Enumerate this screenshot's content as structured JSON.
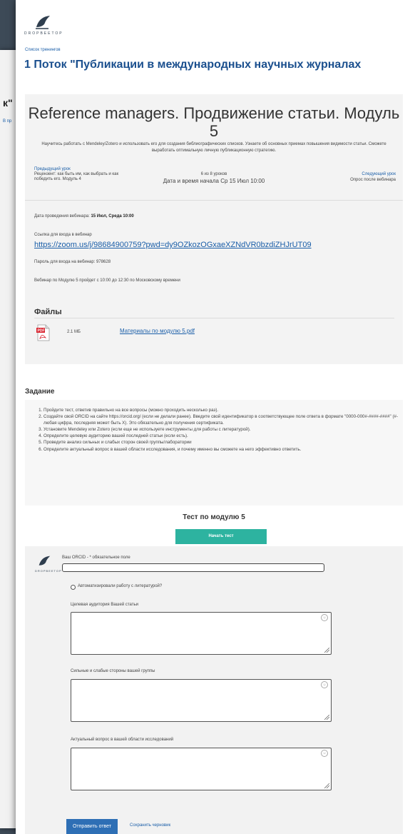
{
  "background_window": {
    "title_fragment": "к\"",
    "link_fragment": "В пр"
  },
  "logo": {
    "brand": "DROPBEETOP"
  },
  "breadcrumb": "Список тренингов",
  "course_title": "1 Поток \"Публикации в международных научных журналах",
  "module": {
    "title": "Reference managers. Продвижение статьи. Модуль 5",
    "description": "Научитесь работать с Mendeley/Zotero и использовать его для создания библиографических списков. Узнаете об основных приемах повышения видимости статьи. Сможете выработать оптимальную личную публикационную стратегию.",
    "prev_label": "Предыдущий урок",
    "prev_title": "Рецензент: как быть им, как выбрать и как победить его. Модуль 4",
    "lesson_count": "6 из 8 уроков",
    "start_date": "Дата и время начала Ср 15 Июл 10:00",
    "next_label": "Следующий урок",
    "next_title": "Опрос после вебинара",
    "webinar_date_label": "Дата проведения вебинара:",
    "webinar_date_value": "15 Июл, Среда 10:00",
    "zoom_label": "Ссылка для входа в вебинар",
    "zoom_link": "https://zoom.us/j/98684900759?pwd=dy9OZkozOGxaeXZNdVR0bzdiZHJrUT09",
    "password": "Пароль для входа на вебинар: 978628",
    "schedule": "Вебинар по Модулю 5 пройдет с 10:00 до 12:30 по Московскому времени",
    "files_title": "Файлы",
    "file_size": "2.1 MБ",
    "file_name": "Материалы по модулю 5.pdf"
  },
  "task": {
    "title": "Задание",
    "items": [
      "Пройдите тест, ответив правильно на все вопросы (можно проходить несколько раз).",
      "Создайте свой ORCID на сайте https://orcid.org/ (если не делали ранее). Введите свой идентификатор в соответствующее поле ответа в формате \"0000-000#-####-####\" (#-любая цифра, последняя может быть X). Это обязательно для получения сертификата.",
      "Установите Mendeley или Zotero (если еще не используете инструменты для работы с литературой).",
      "Определите целевую аудиторию вашей последней статьи (если есть).",
      "Проведите анализ сильных и слабых сторон своей группы/лаборатории",
      "Определите актуальный вопрос в вашей области исследования, и почему именно вы сможете на него эффективно ответить."
    ],
    "test_title": "Тест по модулю 5",
    "start_button": "Начать тест"
  },
  "form": {
    "avatar_brand": "DROPBEETOP",
    "orcid_label": "Ваш ORCID - * обязательное поле",
    "checkbox_label": "Автоматизировали работу с литературой?",
    "audience_label": "Целевая аудитория Вашей статьи",
    "strengths_label": "Сильные и слабые стороны вашей группы",
    "question_label": "Актуальный вопрос в вашей области исследований",
    "submit_button": "Отправить ответ",
    "save_draft": "Сохранить черновик"
  },
  "colors": {
    "accent_teal": "#2db3a0",
    "button_blue": "#2e6fb5",
    "link_blue": "#1a5ea8",
    "title_blue": "#1a4f8e"
  }
}
